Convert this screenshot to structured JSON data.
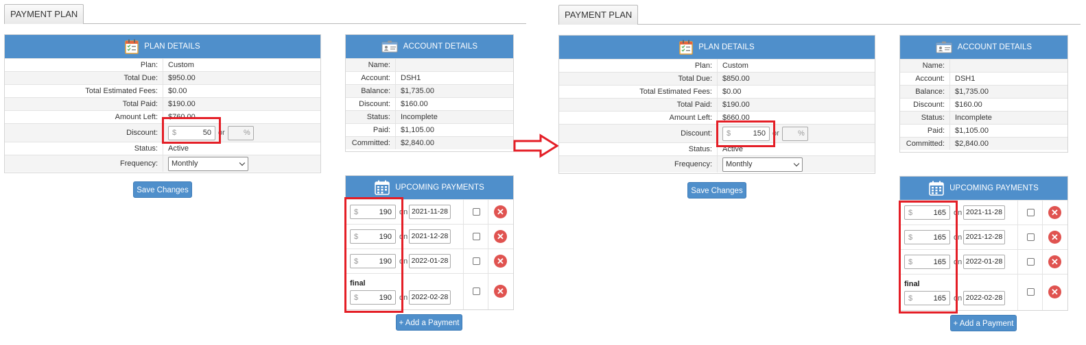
{
  "labels": {
    "tab": "PAYMENT PLAN",
    "plan_header": "PLAN DETAILS",
    "account_header": "ACCOUNT DETAILS",
    "upcoming_header": "UPCOMING PAYMENTS",
    "plan_key": "Plan:",
    "total_due_key": "Total Due:",
    "fees_key": "Total Estimated Fees:",
    "paid_key": "Total Paid:",
    "left_key": "Amount Left:",
    "discount_key": "Discount:",
    "status_key": "Status:",
    "frequency_key": "Frequency:",
    "name_key": "Name:",
    "account_key": "Account:",
    "balance_key": "Balance:",
    "acct_discount_key": "Discount:",
    "acct_status_key": "Status:",
    "acct_paid_key": "Paid:",
    "committed_key": "Committed:",
    "currency": "$",
    "or": "or",
    "percent": "%",
    "on": "on",
    "final": "final",
    "save_button": "Save Changes",
    "add_button": "+ Add a Payment",
    "remove_glyph": "✕"
  },
  "before": {
    "plan": "Custom",
    "total_due": "$950.00",
    "fees": "$0.00",
    "paid": "$190.00",
    "left": "$760.00",
    "discount": "50",
    "status": "Active",
    "frequency": "Monthly",
    "account": {
      "name": "",
      "account": "DSH1",
      "balance": "$1,735.00",
      "discount": "$160.00",
      "status": "Incomplete",
      "paid": "$1,105.00",
      "committed": "$2,840.00"
    },
    "payments": [
      {
        "amount": "190",
        "date": "2021-11-28"
      },
      {
        "amount": "190",
        "date": "2021-12-28"
      },
      {
        "amount": "190",
        "date": "2022-01-28"
      },
      {
        "amount": "190",
        "date": "2022-02-28"
      }
    ]
  },
  "after": {
    "plan": "Custom",
    "total_due": "$850.00",
    "fees": "$0.00",
    "paid": "$190.00",
    "left": "$660.00",
    "discount": "150",
    "status": "Active",
    "frequency": "Monthly",
    "account": {
      "name": "",
      "account": "DSH1",
      "balance": "$1,735.00",
      "discount": "$160.00",
      "status": "Incomplete",
      "paid": "$1,105.00",
      "committed": "$2,840.00"
    },
    "payments": [
      {
        "amount": "165",
        "date": "2021-11-28"
      },
      {
        "amount": "165",
        "date": "2021-12-28"
      },
      {
        "amount": "165",
        "date": "2022-01-28"
      },
      {
        "amount": "165",
        "date": "2022-02-28"
      }
    ]
  },
  "colors": {
    "header_blue": "#4f8fcb",
    "highlight_red": "#e41e26",
    "remove_red": "#e05350",
    "link_blue": "#4a7ab8"
  },
  "icons": {
    "plan_header": "checklist-calendar-icon",
    "account_header": "id-card-icon",
    "upcoming_header": "calendar-grid-icon",
    "remove": "remove-x-icon",
    "frequency": "chevron-down-icon",
    "transition": "right-arrow-icon"
  }
}
